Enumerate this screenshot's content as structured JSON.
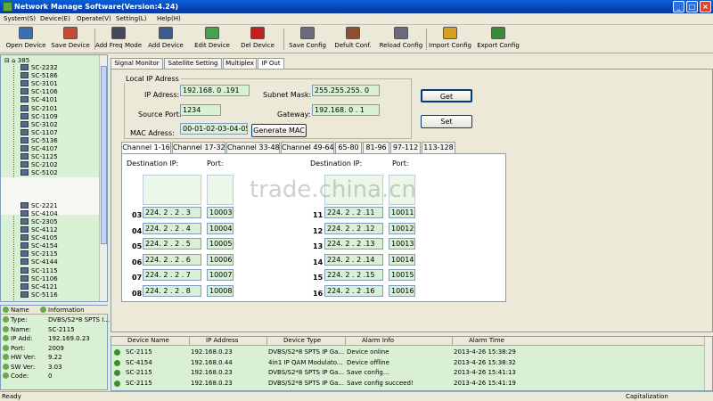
{
  "window": {
    "title": "Network Manage Software(Version:4.24)",
    "buttons": [
      "_",
      "□",
      "×"
    ]
  },
  "menu": [
    "System(S)",
    "Device(E)",
    "Operate(V)",
    "Setting(L)",
    "Help(H)"
  ],
  "toolbar": [
    {
      "label": "Open Device",
      "color": "#3a6fb0"
    },
    {
      "label": "Save Device",
      "color": "#c24b3a"
    },
    {
      "label": "Add Freq Mode",
      "color": "#444a5a"
    },
    {
      "label": "Add Device",
      "color": "#3e5c8a"
    },
    {
      "label": "Edit Device",
      "color": "#47a14f"
    },
    {
      "label": "Del Device",
      "color": "#c02020"
    },
    {
      "label": "Save Config",
      "color": "#6a6a7a"
    },
    {
      "label": "Defult Conf.",
      "color": "#8a5030"
    },
    {
      "label": "Reload Config",
      "color": "#6a6a7a"
    },
    {
      "label": "Import Config",
      "color": "#d8a020"
    },
    {
      "label": "Export Config",
      "color": "#3a8a3a"
    }
  ],
  "tree": {
    "root": "385",
    "items": [
      "SC-2232",
      "SC-5186",
      "SC-3101",
      "SC-1106",
      "SC-4101",
      "SC-2101",
      "SC-1109",
      "SC-3102",
      "SC-1107",
      "SC-5136",
      "SC-4107",
      "SC-1125",
      "SC-2102",
      "SC-5102",
      "",
      "",
      "",
      "SC-2221",
      "SC-4104",
      "SC-2305",
      "SC-4112",
      "SC-4105",
      "SC-4154",
      "SC-2115",
      "SC-4144",
      "SC-1115",
      "SC-1106",
      "SC-4121",
      "SC-5116"
    ]
  },
  "info": {
    "headers": [
      "Name",
      "Information"
    ],
    "rows": [
      {
        "k": "Type:",
        "v": "DVBS/S2*8 SPTS I..."
      },
      {
        "k": "Name:",
        "v": "SC-2115"
      },
      {
        "k": "IP Add:",
        "v": "192.169.0.23"
      },
      {
        "k": "Port:",
        "v": "2009"
      },
      {
        "k": "HW Ver:",
        "v": "9.22"
      },
      {
        "k": "SW Ver:",
        "v": "3.03"
      },
      {
        "k": "Code:",
        "v": "0"
      }
    ]
  },
  "tabs": [
    "Signal Monitor",
    "Satellite Setting",
    "Multiplex",
    "IP Out"
  ],
  "local_ip": {
    "group_title": "Local IP Adress",
    "ip_label": "IP Adress:",
    "ip_value": "192.168. 0 .191",
    "mask_label": "Subnet Mask:",
    "mask_value": "255.255.255. 0",
    "port_label": "Source Port:",
    "port_value": "1234",
    "gateway_label": "Gateway:",
    "gateway_value": "192.168. 0 . 1",
    "mac_label": "MAC Adress:",
    "mac_value": "00-01-02-03-04-05",
    "gen_mac": "Generate MAC",
    "get": "Get",
    "set": "Set"
  },
  "channel_tabs": [
    "Channel 1-16",
    "Channel 17-32",
    "Channel 33-48",
    "Channel 49-64",
    "65-80",
    "81-96",
    "97-112",
    "113-128"
  ],
  "channel_headers": {
    "dest": "Destination IP:",
    "port": "Port:"
  },
  "channels_left": [
    {
      "n": "03",
      "ip": "224. 2 . 2 . 3",
      "port": "10003"
    },
    {
      "n": "04",
      "ip": "224. 2 . 2 . 4",
      "port": "10004"
    },
    {
      "n": "05",
      "ip": "224. 2 . 2 . 5",
      "port": "10005"
    },
    {
      "n": "06",
      "ip": "224. 2 . 2 . 6",
      "port": "10006"
    },
    {
      "n": "07",
      "ip": "224. 2 . 2 . 7",
      "port": "10007"
    },
    {
      "n": "08",
      "ip": "224. 2 . 2 . 8",
      "port": "10008"
    }
  ],
  "channels_right": [
    {
      "n": "11",
      "ip": "224. 2 . 2 .11",
      "port": "10011"
    },
    {
      "n": "12",
      "ip": "224. 2 . 2 .12",
      "port": "10012"
    },
    {
      "n": "13",
      "ip": "224. 2 . 2 .13",
      "port": "10013"
    },
    {
      "n": "14",
      "ip": "224. 2 . 2 .14",
      "port": "10014"
    },
    {
      "n": "15",
      "ip": "224. 2 . 2 .15",
      "port": "10015"
    },
    {
      "n": "16",
      "ip": "224. 2 . 2 .16",
      "port": "10016"
    }
  ],
  "watermark": "trade.china.cn",
  "alarm": {
    "headers": [
      "Device Name",
      "IP Address",
      "Device Type",
      "Alarm Info",
      "Alarm Time"
    ],
    "rows": [
      [
        "SC-2115",
        "192.168.0.23",
        "DVBS/S2*8 SPTS IP Ga...",
        "Device online",
        "2013-4-26 15:38:29"
      ],
      [
        "SC-4154",
        "192.168.0.44",
        "4in1 IP QAM Modulato...",
        "Device offline",
        "2013-4-26 15:38:32"
      ],
      [
        "SC-2115",
        "192.168.0.23",
        "DVBS/S2*8 SPTS IP Ga...",
        "Save config...",
        "2013-4-26 15:41:13"
      ],
      [
        "SC-2115",
        "192.168.0.23",
        "DVBS/S2*8 SPTS IP Ga...",
        "Save config succeed!",
        "2013-4-26 15:41:19"
      ]
    ]
  },
  "status": {
    "left": "Ready",
    "right": "Capitalization"
  }
}
